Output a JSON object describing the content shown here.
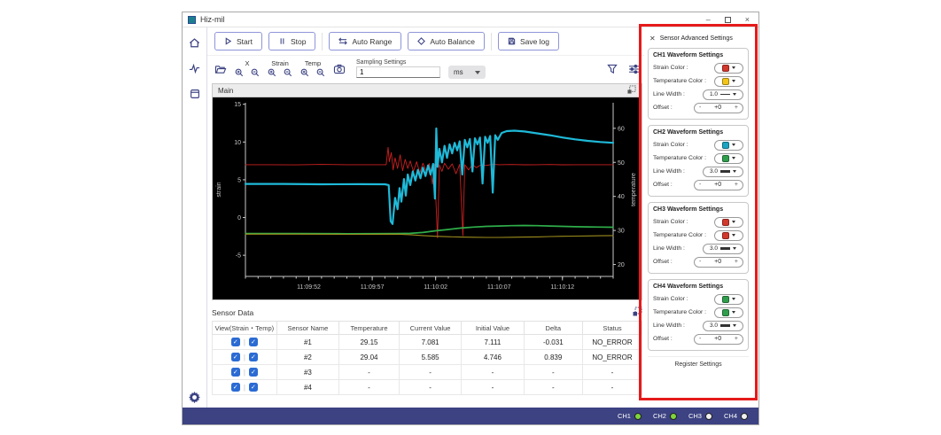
{
  "window": {
    "title": "Hiz-mil"
  },
  "icons": {
    "minimize": "–",
    "close": "×",
    "check": "✓",
    "panel_close": "✕",
    "minus": "-",
    "plus": "+"
  },
  "toolbar": {
    "start": "Start",
    "stop": "Stop",
    "auto_range": "Auto Range",
    "auto_balance": "Auto Balance",
    "save_log": "Save log"
  },
  "toolbar2": {
    "zoom_groups": [
      {
        "label": "X"
      },
      {
        "label": "Strain"
      },
      {
        "label": "Temp"
      }
    ],
    "sampling_label": "Sampling Settings",
    "sampling_value": "1",
    "unit": "ms"
  },
  "chart_data": {
    "type": "line",
    "title": "Main",
    "background": "#000000",
    "x_axis": {
      "range": [
        0,
        29
      ],
      "minor_step": 1,
      "ticks": [
        {
          "t": 5,
          "label": "11:09:52"
        },
        {
          "t": 10,
          "label": "11:09:57"
        },
        {
          "t": 15,
          "label": "11:10:02"
        },
        {
          "t": 20,
          "label": "11:10:07"
        },
        {
          "t": 25,
          "label": "11:10:12"
        }
      ]
    },
    "y_left": {
      "label": "strain",
      "range": [
        -7.8,
        15.2
      ],
      "ticks": [
        -5,
        0,
        5,
        10,
        15
      ]
    },
    "y_right": {
      "label": "temperature",
      "range": [
        16.5,
        67.5
      ],
      "ticks": [
        20,
        30,
        40,
        50,
        60
      ]
    },
    "series": [
      {
        "name": "CH1 strain",
        "color": "#cc2020",
        "width": 0.9,
        "axis": "left",
        "points": [
          [
            0,
            7
          ],
          [
            2,
            7
          ],
          [
            4,
            6.97
          ],
          [
            6,
            7.03
          ],
          [
            8,
            7
          ],
          [
            10,
            7
          ],
          [
            11.1,
            7
          ],
          [
            11.25,
            9.3
          ],
          [
            11.35,
            7.4
          ],
          [
            11.5,
            8.6
          ],
          [
            11.65,
            6.3
          ],
          [
            11.8,
            7.9
          ],
          [
            12,
            6.5
          ],
          [
            12.2,
            8.3
          ],
          [
            12.4,
            6.2
          ],
          [
            12.6,
            7.7
          ],
          [
            12.8,
            6.5
          ],
          [
            13,
            7.5
          ],
          [
            13.25,
            6.1
          ],
          [
            13.5,
            7.4
          ],
          [
            13.75,
            5.9
          ],
          [
            14,
            7.2
          ],
          [
            14.25,
            6.2
          ],
          [
            14.5,
            7.15
          ],
          [
            14.75,
            4.4
          ],
          [
            14.9,
            7.05
          ],
          [
            15.15,
            -2.7
          ],
          [
            15.3,
            7
          ],
          [
            15.5,
            6.1
          ],
          [
            15.7,
            7.2
          ],
          [
            16,
            6.4
          ],
          [
            16.3,
            7.1
          ],
          [
            16.6,
            5.8
          ],
          [
            16.9,
            7.05
          ],
          [
            17.15,
            -2.4
          ],
          [
            17.3,
            7
          ],
          [
            17.6,
            6.3
          ],
          [
            17.9,
            7.05
          ],
          [
            18.2,
            6.6
          ],
          [
            18.6,
            7
          ],
          [
            19,
            6.9
          ],
          [
            19.5,
            7.05
          ],
          [
            20,
            7
          ],
          [
            21,
            7.02
          ],
          [
            22,
            6.98
          ],
          [
            23,
            7
          ],
          [
            24,
            7.02
          ],
          [
            25,
            6.98
          ],
          [
            26,
            7
          ],
          [
            27,
            7
          ],
          [
            28,
            7
          ],
          [
            29,
            7
          ]
        ]
      },
      {
        "name": "CH2 strain",
        "color": "#1fb9d8",
        "width": 2.2,
        "axis": "left",
        "points": [
          [
            0,
            4.45
          ],
          [
            3,
            4.45
          ],
          [
            6,
            4.4
          ],
          [
            9,
            4.42
          ],
          [
            11,
            4.4
          ],
          [
            11.3,
            4.3
          ],
          [
            11.45,
            -0.5
          ],
          [
            11.6,
            -0.85
          ],
          [
            11.8,
            2.6
          ],
          [
            12,
            1.1
          ],
          [
            12.15,
            3.9
          ],
          [
            12.3,
            2.1
          ],
          [
            12.5,
            5.1
          ],
          [
            12.65,
            2.9
          ],
          [
            12.8,
            5.7
          ],
          [
            13,
            4.3
          ],
          [
            13.2,
            6.1
          ],
          [
            13.4,
            4.9
          ],
          [
            13.6,
            6.3
          ],
          [
            13.8,
            5.2
          ],
          [
            14,
            6.6
          ],
          [
            14.2,
            5.5
          ],
          [
            14.4,
            6.9
          ],
          [
            14.6,
            5.7
          ],
          [
            14.8,
            7.1
          ],
          [
            14.95,
            2.5
          ],
          [
            15.05,
            11.8
          ],
          [
            15.15,
            6.7
          ],
          [
            15.3,
            9.1
          ],
          [
            15.5,
            7.3
          ],
          [
            15.7,
            9.5
          ],
          [
            15.9,
            7.9
          ],
          [
            16.1,
            9.7
          ],
          [
            16.3,
            8.5
          ],
          [
            16.5,
            9.9
          ],
          [
            16.7,
            8.9
          ],
          [
            16.9,
            10.1
          ],
          [
            17.1,
            5.7
          ],
          [
            17.3,
            10.3
          ],
          [
            17.5,
            9.3
          ],
          [
            17.7,
            10.4
          ],
          [
            17.9,
            6.1
          ],
          [
            18.1,
            10.5
          ],
          [
            18.3,
            9.7
          ],
          [
            18.5,
            10.6
          ],
          [
            18.7,
            4.5
          ],
          [
            18.9,
            10.7
          ],
          [
            19.1,
            9.9
          ],
          [
            19.3,
            10.8
          ],
          [
            19.5,
            3.3
          ],
          [
            19.7,
            10.9
          ],
          [
            19.9,
            10.3
          ],
          [
            20.2,
            11.2
          ],
          [
            20.6,
            11.45
          ],
          [
            21.2,
            11.5
          ],
          [
            22,
            11.4
          ],
          [
            23,
            11.15
          ],
          [
            24,
            10.9
          ],
          [
            25,
            10.6
          ],
          [
            26,
            10.35
          ],
          [
            27,
            10.15
          ],
          [
            28,
            10
          ],
          [
            29,
            9.9
          ]
        ]
      },
      {
        "name": "CH2 temperature",
        "color": "#2fae4a",
        "width": 1.7,
        "axis": "right",
        "points": [
          [
            0,
            29.1
          ],
          [
            4,
            29.1
          ],
          [
            8,
            29.05
          ],
          [
            12,
            29.1
          ],
          [
            13,
            29.15
          ],
          [
            14,
            29.4
          ],
          [
            15,
            29.9
          ],
          [
            16,
            30.3
          ],
          [
            17,
            30.7
          ],
          [
            18,
            31
          ],
          [
            19,
            31.2
          ],
          [
            20,
            31.3
          ],
          [
            21,
            31.4
          ],
          [
            22,
            31.45
          ],
          [
            23,
            31.4
          ],
          [
            24,
            31.3
          ],
          [
            25,
            31.2
          ],
          [
            26,
            31.1
          ],
          [
            27,
            31.05
          ],
          [
            28,
            31
          ],
          [
            29,
            30.95
          ]
        ]
      },
      {
        "name": "CH1 temperature",
        "color": "#9c8c1c",
        "width": 1.1,
        "axis": "right",
        "points": [
          [
            0,
            28.9
          ],
          [
            4,
            28.9
          ],
          [
            8,
            28.85
          ],
          [
            12,
            28.9
          ],
          [
            13,
            28.75
          ],
          [
            14,
            28.5
          ],
          [
            15,
            28.3
          ],
          [
            16,
            28.15
          ],
          [
            17,
            28.05
          ],
          [
            18,
            28
          ],
          [
            19,
            27.95
          ],
          [
            20,
            27.95
          ],
          [
            21,
            28
          ],
          [
            22,
            28.05
          ],
          [
            23,
            28.1
          ],
          [
            24,
            28.2
          ],
          [
            25,
            28.3
          ],
          [
            26,
            28.35
          ],
          [
            27,
            28.4
          ],
          [
            28,
            28.45
          ],
          [
            29,
            28.5
          ]
        ]
      }
    ]
  },
  "sensor_table": {
    "title": "Sensor Data",
    "columns": [
      "View(Strain・Temp)",
      "Sensor Name",
      "Temperature",
      "Current Value",
      "Initial Value",
      "Delta",
      "Status"
    ],
    "rows": [
      {
        "name": "#1",
        "temperature": "29.15",
        "current": "7.081",
        "initial": "7.111",
        "delta": "-0.031",
        "status": "NO_ERROR"
      },
      {
        "name": "#2",
        "temperature": "29.04",
        "current": "5.585",
        "initial": "4.746",
        "delta": "0.839",
        "status": "NO_ERROR"
      },
      {
        "name": "#3",
        "temperature": "-",
        "current": "-",
        "initial": "-",
        "delta": "-",
        "status": "-"
      },
      {
        "name": "#4",
        "temperature": "-",
        "current": "-",
        "initial": "-",
        "delta": "-",
        "status": "-"
      }
    ]
  },
  "settings_panel": {
    "title": "Sensor Advanced Settings",
    "register_button": "Register Settings",
    "labels": {
      "strain": "Strain Color :",
      "temp": "Temperature Color :",
      "line_width": "Line Width :",
      "offset": "Offset :"
    },
    "channels": [
      {
        "title": "CH1 Waveform Settings",
        "strain_color": "#d3382c",
        "temp_color": "#f3c517",
        "line_width": "1.0",
        "offset_value": "+0"
      },
      {
        "title": "CH2 Waveform Settings",
        "strain_color": "#1aa4c2",
        "temp_color": "#2f9e4c",
        "line_width": "3.0",
        "offset_value": "+0"
      },
      {
        "title": "CH3 Waveform Settings",
        "strain_color": "#d3382c",
        "temp_color": "#d3382c",
        "line_width": "3.0",
        "offset_value": "+0"
      },
      {
        "title": "CH4 Waveform Settings",
        "strain_color": "#2f9e4c",
        "temp_color": "#2f9e4c",
        "line_width": "3.0",
        "offset_value": "+0"
      }
    ]
  },
  "status_bar": {
    "channels": [
      {
        "label": "CH1",
        "on": true
      },
      {
        "label": "CH2",
        "on": true
      },
      {
        "label": "CH3",
        "on": false
      },
      {
        "label": "CH4",
        "on": false
      }
    ],
    "led_on_color": "#7ed63a",
    "led_off_color": "#f0f0f0"
  }
}
